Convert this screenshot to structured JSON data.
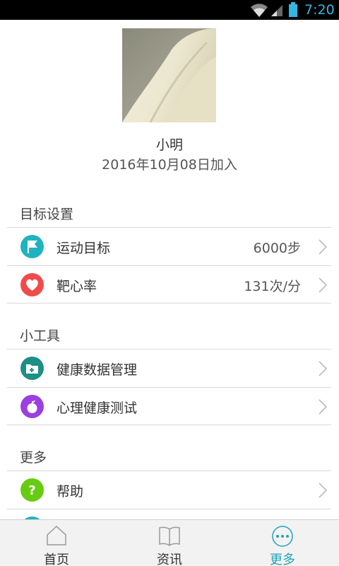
{
  "status_bar": {
    "time": "7:20"
  },
  "profile": {
    "name": "小明",
    "joined": "2016年10月08日加入"
  },
  "sections": {
    "goals": {
      "title": "目标设置",
      "items": [
        {
          "label": "运动目标",
          "value": "6000步",
          "icon": "flag-icon",
          "color": "#1fb3bf"
        },
        {
          "label": "靶心率",
          "value": "131次/分",
          "icon": "heart-icon",
          "color": "#f04b4b"
        }
      ]
    },
    "tools": {
      "title": "小工具",
      "items": [
        {
          "label": "健康数据管理",
          "icon": "health-folder-icon",
          "color": "#1d8f87"
        },
        {
          "label": "心理健康测试",
          "icon": "apple-icon",
          "color": "#9b3fe0"
        }
      ]
    },
    "more": {
      "title": "更多",
      "items": [
        {
          "label": "帮助",
          "icon": "help-icon",
          "color": "#66cc11"
        }
      ]
    }
  },
  "tabs": [
    {
      "label": "首页",
      "icon": "home-icon"
    },
    {
      "label": "资讯",
      "icon": "book-icon"
    },
    {
      "label": "更多",
      "icon": "more-icon",
      "active": true
    }
  ],
  "colors": {
    "accent": "#1fa5b5"
  }
}
